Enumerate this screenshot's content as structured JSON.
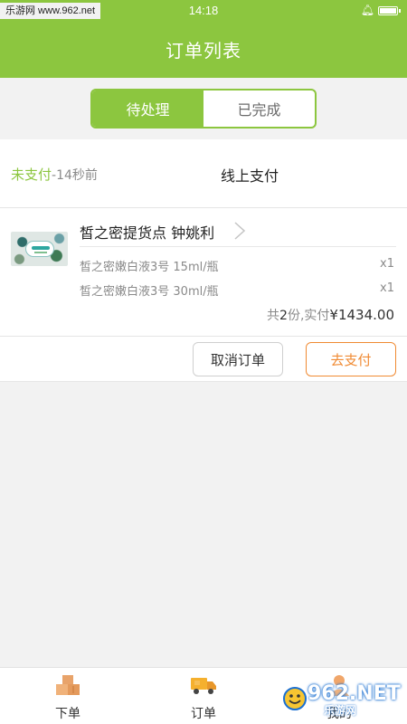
{
  "statusbar": {
    "watermark": "乐游网 www.962.net",
    "time": "14:18",
    "battery_level": 0.9
  },
  "navbar": {
    "title": "订单列表"
  },
  "tabs": [
    {
      "label": "待处理",
      "active": true
    },
    {
      "label": "已完成",
      "active": false
    }
  ],
  "order": {
    "status": "未支付",
    "ago": "-14秒前",
    "pay_type": "线上支付",
    "store": "皙之密提货点 钟姚利",
    "items": [
      {
        "name": "皙之密嫩白液3号  15ml/瓶",
        "qty": "x1"
      },
      {
        "name": "皙之密嫩白液3号  30ml/瓶",
        "qty": "x1"
      }
    ],
    "summary": {
      "prefix": "共",
      "count": "2",
      "mid": "份,实付",
      "price": "¥1434.00"
    },
    "buttons": {
      "cancel": "取消订单",
      "pay": "去支付"
    }
  },
  "bottom_nav": [
    {
      "label": "下单",
      "icon": "boxes-icon"
    },
    {
      "label": "订单",
      "icon": "truck-icon"
    },
    {
      "label": "我的",
      "icon": "user-icon"
    }
  ],
  "site_watermark": {
    "text": "962.NET",
    "sub": "乐游网"
  },
  "colors": {
    "primary": "#8cc63f",
    "accent": "#f08a32"
  }
}
